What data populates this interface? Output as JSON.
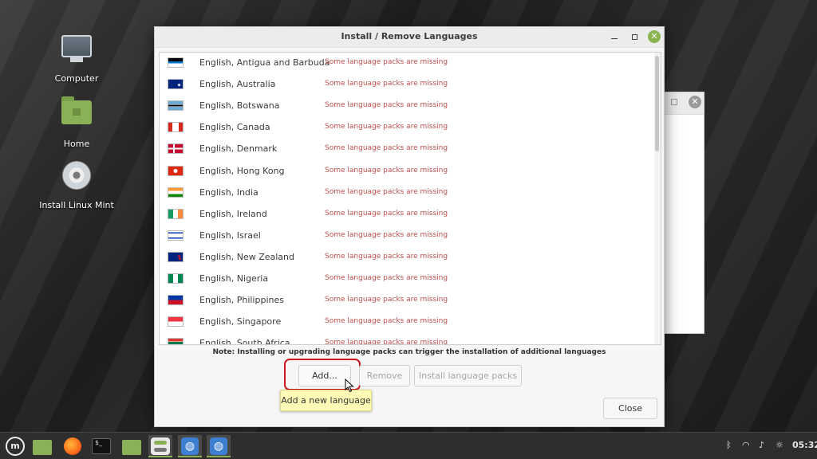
{
  "desktop": {
    "icons": [
      {
        "label": "Computer",
        "icon": "monitor-icon"
      },
      {
        "label": "Home",
        "icon": "home-folder-icon"
      },
      {
        "label": "Install Linux Mint",
        "icon": "disc-icon"
      }
    ]
  },
  "dialog": {
    "title": "Install / Remove Languages",
    "languages": [
      {
        "name": "English, Antigua and Barbuda",
        "status": "Some language packs are missing",
        "flag": "antigua-flag-icon"
      },
      {
        "name": "English, Australia",
        "status": "Some language packs are missing",
        "flag": "australia-flag-icon"
      },
      {
        "name": "English, Botswana",
        "status": "Some language packs are missing",
        "flag": "botswana-flag-icon"
      },
      {
        "name": "English, Canada",
        "status": "Some language packs are missing",
        "flag": "canada-flag-icon"
      },
      {
        "name": "English, Denmark",
        "status": "Some language packs are missing",
        "flag": "denmark-flag-icon"
      },
      {
        "name": "English, Hong Kong",
        "status": "Some language packs are missing",
        "flag": "hong-kong-flag-icon"
      },
      {
        "name": "English, India",
        "status": "Some language packs are missing",
        "flag": "india-flag-icon"
      },
      {
        "name": "English, Ireland",
        "status": "Some language packs are missing",
        "flag": "ireland-flag-icon"
      },
      {
        "name": "English, Israel",
        "status": "Some language packs are missing",
        "flag": "israel-flag-icon"
      },
      {
        "name": "English, New Zealand",
        "status": "Some language packs are missing",
        "flag": "new-zealand-flag-icon"
      },
      {
        "name": "English, Nigeria",
        "status": "Some language packs are missing",
        "flag": "nigeria-flag-icon"
      },
      {
        "name": "English, Philippines",
        "status": "Some language packs are missing",
        "flag": "philippines-flag-icon"
      },
      {
        "name": "English, Singapore",
        "status": "Some language packs are missing",
        "flag": "singapore-flag-icon"
      },
      {
        "name": "English, South Africa",
        "status": "Some language packs are missing",
        "flag": "south-africa-flag-icon"
      }
    ],
    "note": "Note: Installing or upgrading language packs can trigger the installation of additional languages",
    "buttons": {
      "add": "Add...",
      "remove": "Remove",
      "install": "Install language packs",
      "close": "Close"
    },
    "tooltip": "Add a new language"
  },
  "taskbar": {
    "clock": "05:32",
    "tray_icons": [
      "bluetooth-icon",
      "wifi-icon",
      "volume-icon",
      "brightness-icon"
    ]
  },
  "colors": {
    "accent": "#8bb158",
    "status_text": "#c0504d",
    "highlight": "#d0161b"
  }
}
